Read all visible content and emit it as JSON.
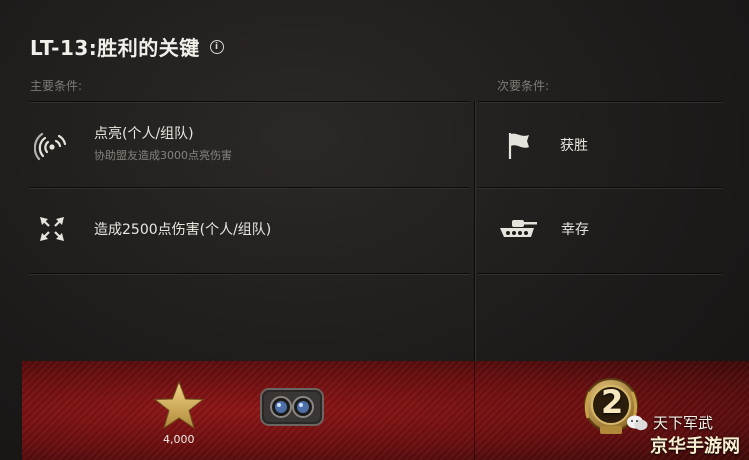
{
  "title": "LT-13:胜利的关键",
  "primary_label": "主要条件:",
  "secondary_label": "次要条件:",
  "primary": [
    {
      "title": "点亮(个人/组队)",
      "subtitle": "协助盟友造成3000点亮伤害",
      "icon": "radar-icon"
    },
    {
      "title": "造成2500点伤害(个人/组队)",
      "icon": "crosshair-icon"
    }
  ],
  "secondary": [
    {
      "title": "获胜",
      "icon": "flag-icon"
    },
    {
      "title": "幸存",
      "icon": "tank-icon"
    }
  ],
  "rewards": {
    "star_value": "4,000",
    "badge_number": "2"
  },
  "watermark": {
    "line1": "天下军武",
    "line2": "京华手游网"
  },
  "colors": {
    "reward_red": "#8e1616",
    "gold": "#c9a24a"
  }
}
